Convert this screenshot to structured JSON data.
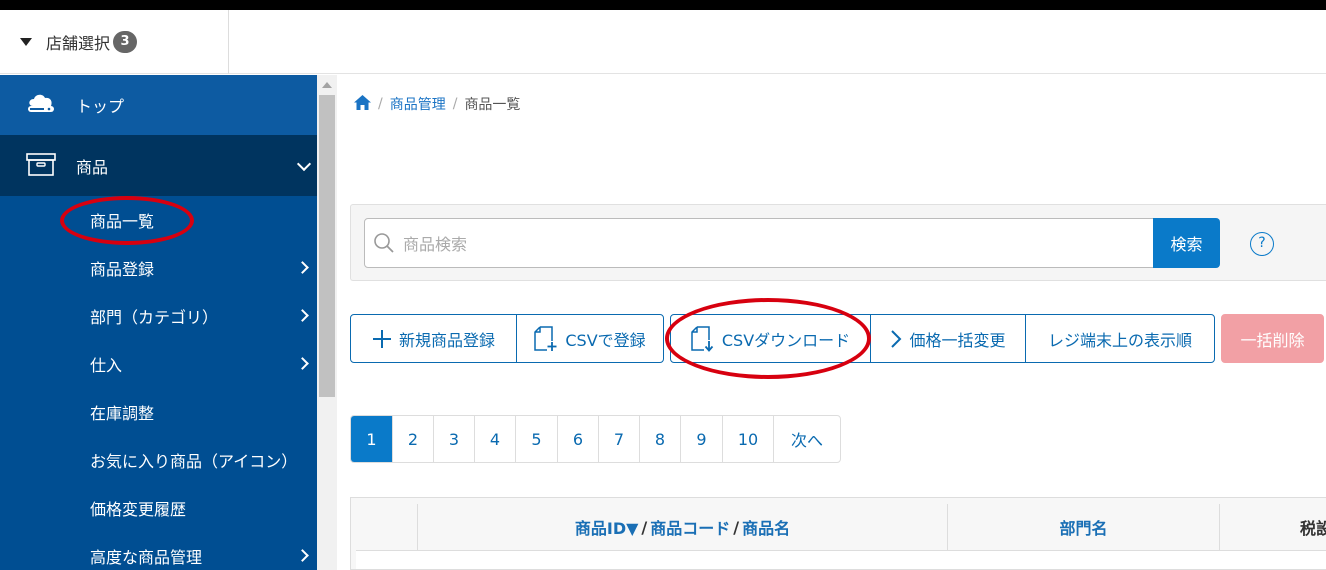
{
  "header": {
    "store_select_label": "店舗選択",
    "store_count": "3"
  },
  "sidebar": {
    "top_label": "トップ",
    "product_label": "商品",
    "items": [
      {
        "label": "商品一覧",
        "has_arrow": false
      },
      {
        "label": "商品登録",
        "has_arrow": true
      },
      {
        "label": "部門（カテゴリ）",
        "has_arrow": true
      },
      {
        "label": "仕入",
        "has_arrow": true
      },
      {
        "label": "在庫調整",
        "has_arrow": false
      },
      {
        "label": "お気に入り商品（アイコン）",
        "has_arrow": false
      },
      {
        "label": "価格変更履歴",
        "has_arrow": false
      },
      {
        "label": "高度な商品管理",
        "has_arrow": true
      }
    ]
  },
  "breadcrumb": {
    "level1": "商品管理",
    "level2": "商品一覧"
  },
  "search": {
    "placeholder": "商品検索",
    "button_label": "検索",
    "help": "?"
  },
  "toolbar": {
    "new_product": "新規商品登録",
    "csv_register": "CSVで登録",
    "csv_download": "CSVダウンロード",
    "bulk_price": "価格一括変更",
    "register_order": "レジ端末上の表示順",
    "bulk_delete": "一括削除"
  },
  "pagination": {
    "pages": [
      "1",
      "2",
      "3",
      "4",
      "5",
      "6",
      "7",
      "8",
      "9",
      "10"
    ],
    "next": "次へ",
    "active": "1"
  },
  "table": {
    "col_id": "商品ID▼",
    "col_code": "商品コード",
    "col_name": "商品名",
    "col_dept": "部門名",
    "col_tax": "税設"
  },
  "colors": {
    "sidebar": "#004e92",
    "sidebar_active": "#00345f",
    "accent": "#0a7ac9",
    "danger": "#f2a0a5",
    "annotation": "#d7000f"
  }
}
